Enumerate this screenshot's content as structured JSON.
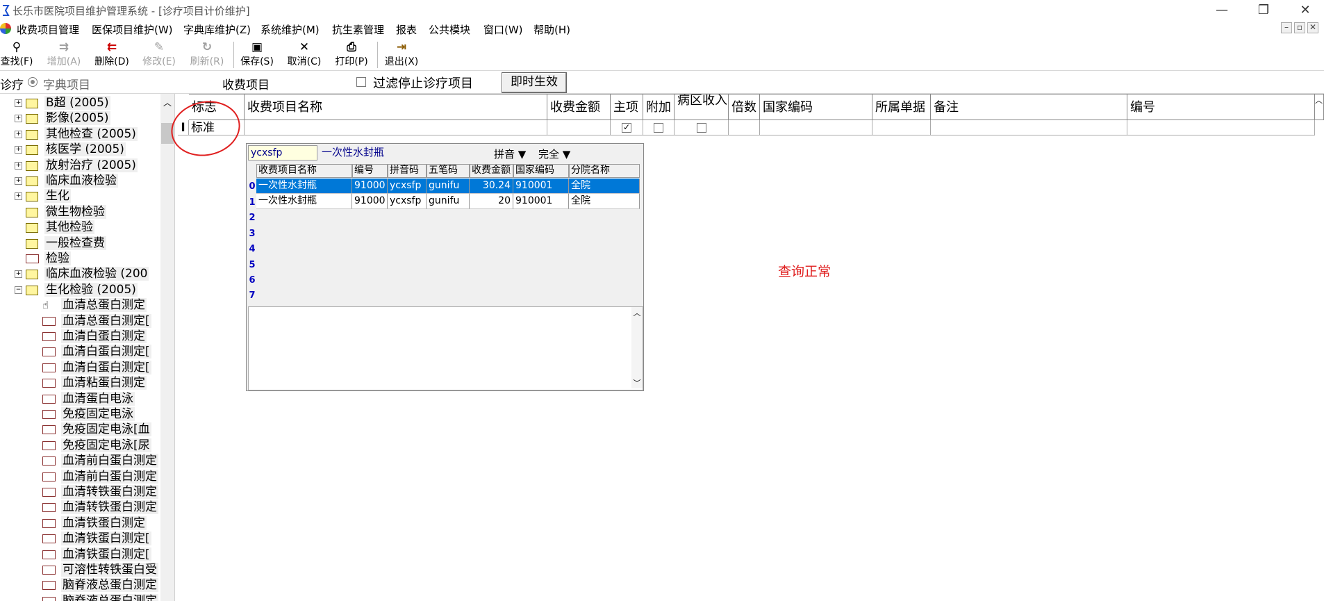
{
  "window": {
    "title": "长乐市医院项目维护管理系统 - [诊疗项目计价维护]",
    "controls": {
      "minimize": "—",
      "restore": "❐",
      "close": "✕"
    }
  },
  "menu": [
    "收费项目管理",
    "医保项目维护(W)",
    "字典库维护(Z)",
    "系统维护(M)",
    "抗生素管理",
    "报表",
    "公共模块",
    "窗口(W)",
    "帮助(H)"
  ],
  "mdi_controls": {
    "minimize": "–",
    "restore": "▫",
    "close": "✕"
  },
  "toolbar": {
    "find": {
      "label": "查找(F)",
      "icon": "binoculars-icon"
    },
    "add": {
      "label": "增加(A)",
      "icon": "add-row-icon"
    },
    "delete": {
      "label": "删除(D)",
      "icon": "delete-row-icon"
    },
    "modify": {
      "label": "修改(E)",
      "icon": "edit-icon"
    },
    "refresh": {
      "label": "刷新(R)",
      "icon": "refresh-icon"
    },
    "save": {
      "label": "保存(S)",
      "icon": "floppy-icon"
    },
    "cancel": {
      "label": "取消(C)",
      "icon": "x-icon"
    },
    "print": {
      "label": "打印(P)",
      "icon": "printer-icon"
    },
    "exit": {
      "label": "退出(X)",
      "icon": "exit-door-icon"
    }
  },
  "subbar": {
    "mode_label": "诊疗",
    "dict_radio": "字典项目",
    "charge_label": "收费项目",
    "filter_label": "过滤停止诊疗项目",
    "apply_button": "即时生效"
  },
  "tree": [
    {
      "label": "B超 (2005)",
      "type": "folder",
      "expand": true
    },
    {
      "label": "影像(2005)",
      "type": "folder",
      "expand": true
    },
    {
      "label": "其他检查 (2005)",
      "type": "folder",
      "expand": true
    },
    {
      "label": "核医学 (2005)",
      "type": "folder",
      "expand": true
    },
    {
      "label": "放射治疗 (2005)",
      "type": "folder",
      "expand": true
    },
    {
      "label": "临床血液检验",
      "type": "folder",
      "expand": true
    },
    {
      "label": "生化",
      "type": "folder",
      "expand": true
    },
    {
      "label": "微生物检验",
      "type": "folder",
      "expand": false
    },
    {
      "label": "其他检验",
      "type": "folder",
      "expand": false
    },
    {
      "label": "一般检查费",
      "type": "folder",
      "expand": false
    },
    {
      "label": "检验",
      "type": "doc",
      "expand": false
    },
    {
      "label": "临床血液检验 (200",
      "type": "folder",
      "expand": true
    },
    {
      "label": "生化检验 (2005)",
      "type": "folder-open",
      "expand": true
    },
    {
      "label": "血清总蛋白测定",
      "type": "hand"
    },
    {
      "label": "血清总蛋白测定[",
      "type": "doc"
    },
    {
      "label": "血清白蛋白测定",
      "type": "doc"
    },
    {
      "label": "血清白蛋白测定[",
      "type": "doc"
    },
    {
      "label": "血清白蛋白测定[",
      "type": "doc"
    },
    {
      "label": "血清粘蛋白测定",
      "type": "doc"
    },
    {
      "label": "血清蛋白电泳",
      "type": "doc"
    },
    {
      "label": "免疫固定电泳",
      "type": "doc"
    },
    {
      "label": "免疫固定电泳[血",
      "type": "doc"
    },
    {
      "label": "免疫固定电泳[尿",
      "type": "doc"
    },
    {
      "label": "血清前白蛋白测定",
      "type": "doc"
    },
    {
      "label": "血清前白蛋白测定",
      "type": "doc"
    },
    {
      "label": "血清转铁蛋白测定",
      "type": "doc"
    },
    {
      "label": "血清转铁蛋白测定",
      "type": "doc"
    },
    {
      "label": "血清铁蛋白测定",
      "type": "doc"
    },
    {
      "label": "血清铁蛋白测定[",
      "type": "doc"
    },
    {
      "label": "血清铁蛋白测定[",
      "type": "doc"
    },
    {
      "label": "可溶性转铁蛋白受",
      "type": "doc"
    },
    {
      "label": "脑脊液总蛋白测定",
      "type": "doc"
    },
    {
      "label": "脑脊液总蛋白测定",
      "type": "doc"
    }
  ],
  "grid": {
    "headers": [
      "标志",
      "收费项目名称",
      "收费金额",
      "主项",
      "附加",
      "病区收入",
      "倍数",
      "国家编码",
      "所属单据",
      "备注",
      "编号"
    ],
    "row": {
      "indicator": "I",
      "flag": "标准",
      "main_checked": "✓"
    }
  },
  "popup": {
    "search_value": "ycxsfp",
    "match_name": "一次性水封瓶",
    "mode1": "拼音",
    "mode2": "完全",
    "columns": [
      "收费项目名称",
      "编号",
      "拼音码",
      "五笔码",
      "收费金额",
      "国家编码",
      "分院名称"
    ],
    "rows": [
      [
        "一次性水封瓶",
        "91000",
        "ycxsfp",
        "gunifu",
        "30.24",
        "910001",
        "全院"
      ],
      [
        "一次性水封瓶",
        "91000",
        "ycxsfp",
        "gunifu",
        "20",
        "910001",
        "全院"
      ]
    ],
    "row_numbers": [
      "0",
      "1",
      "2",
      "3",
      "4",
      "5",
      "6",
      "7"
    ]
  },
  "annotation": "查询正常",
  "colors": {
    "selection": "#0078d7",
    "annotation": "#e02020"
  }
}
